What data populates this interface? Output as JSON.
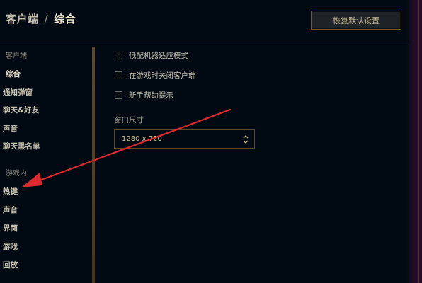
{
  "header": {
    "breadcrumb_parent": "客户端",
    "separator": "/",
    "current": "综合",
    "reset_button": "恢复默认设置"
  },
  "sidebar": {
    "client_section": "客户端",
    "client_items": [
      "综合",
      "通知弹窗",
      "聊天&好友",
      "声音",
      "聊天黑名单"
    ],
    "ingame_section": "游戏内",
    "ingame_items": [
      "热键",
      "声音",
      "界面",
      "游戏",
      "回放"
    ]
  },
  "main": {
    "options": [
      {
        "label": "低配机器适应模式",
        "checked": false
      },
      {
        "label": "在游戏时关闭客户端",
        "checked": false
      },
      {
        "label": "新手帮助提示",
        "checked": false
      }
    ],
    "window_size_label": "窗口尺寸",
    "window_size_value": "1280 x 720"
  },
  "colors": {
    "background": "#010a13",
    "gold": "#785a28",
    "text_light": "#f0e6d2",
    "annotation_arrow": "#e0282e"
  },
  "icons": {
    "select_arrows": "chevron-up-down-icon",
    "annotation": "red-arrow-annotation"
  }
}
